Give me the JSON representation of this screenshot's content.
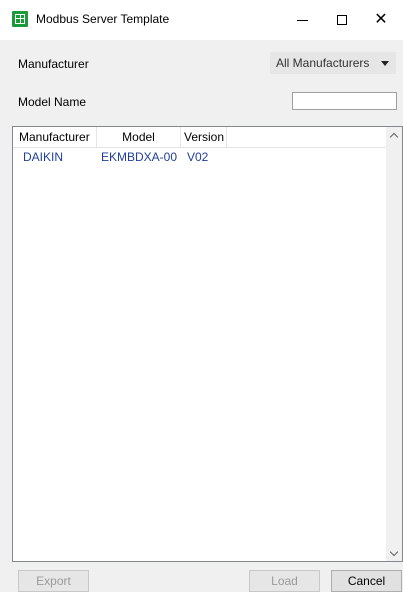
{
  "window": {
    "title": "Modbus Server Template",
    "icon": "grid-table-icon"
  },
  "filters": {
    "manufacturer_label": "Manufacturer",
    "manufacturer_selected": "All Manufacturers",
    "model_name_label": "Model Name",
    "model_name_value": ""
  },
  "table": {
    "columns": [
      "Manufacturer",
      "Model",
      "Version"
    ],
    "rows": [
      [
        "DAIKIN",
        "EKMBDXA-00",
        "V02"
      ]
    ]
  },
  "buttons": {
    "export": "Export",
    "load": "Load",
    "cancel": "Cancel"
  },
  "colors": {
    "app_icon": "#1a9a3a",
    "row_text": "#1f3f9a",
    "disabled_text": "#9a9a9a"
  }
}
